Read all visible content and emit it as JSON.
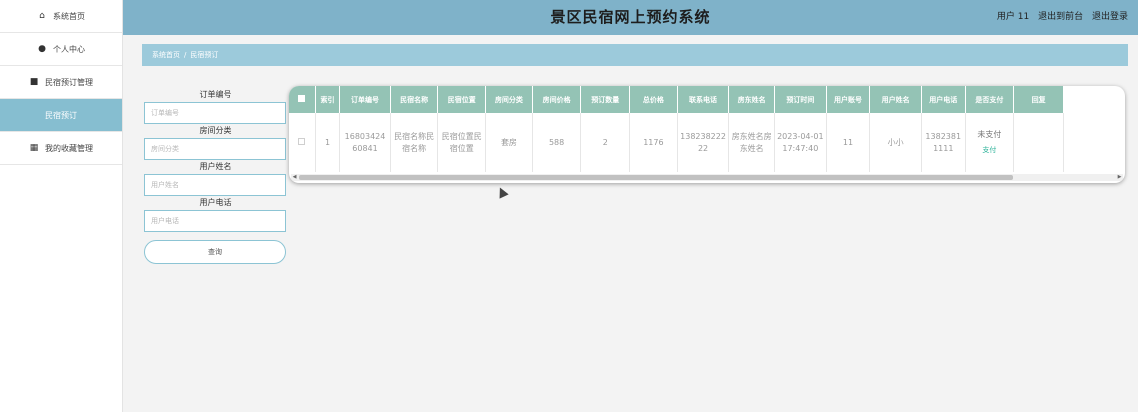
{
  "app": {
    "title": "景区民宿网上预约系统",
    "user_text": "用户 11",
    "back_link": "退出到前台",
    "logout_link": "退出登录"
  },
  "sidebar": {
    "items": [
      {
        "label": "系统首页",
        "icon": "home-icon",
        "glyph": "⌂"
      },
      {
        "label": "个人中心",
        "icon": "user-icon",
        "glyph": "●"
      },
      {
        "label": "民宿预订管理",
        "icon": "briefcase-icon",
        "glyph": "■"
      },
      {
        "label": "民宿预订",
        "icon": "",
        "glyph": ""
      },
      {
        "label": "我的收藏管理",
        "icon": "grid-icon",
        "glyph": "▦"
      }
    ]
  },
  "breadcrumb": {
    "home": "系统首页",
    "separator": "/",
    "current": "民宿预订"
  },
  "search": {
    "fields": [
      {
        "label": "订单编号",
        "placeholder": "订单编号"
      },
      {
        "label": "房间分类",
        "placeholder": "房间分类"
      },
      {
        "label": "用户姓名",
        "placeholder": "用户姓名"
      },
      {
        "label": "用户电话",
        "placeholder": "用户电话"
      }
    ],
    "button": "查询"
  },
  "table": {
    "headers": [
      "索引",
      "订单编号",
      "民宿名称",
      "民宿位置",
      "房间分类",
      "房间价格",
      "预订数量",
      "总价格",
      "联系电话",
      "房东姓名",
      "预订时间",
      "用户账号",
      "用户姓名",
      "用户电话",
      "是否支付",
      "回复"
    ],
    "rows": [
      {
        "index": "1",
        "order_no": "1680342460841",
        "homestay_name": "民宿名称民宿名称",
        "homestay_location": "民宿位置民宿位置",
        "room_type": "套房",
        "room_price": "588",
        "quantity": "2",
        "total_price": "1176",
        "contact_phone": "13823822222",
        "landlord_name": "房东姓名房东姓名",
        "booking_time": "2023-04-01 17:47:40",
        "user_account": "11",
        "user_name": "小小",
        "user_phone": "13823811111",
        "payment_status": "未支付",
        "pay_action": "支付",
        "reply": ""
      }
    ]
  },
  "colors": {
    "topbar": "#7fb2c9",
    "breadcrumb": "#9ccadb",
    "table_header": "#94c3b5",
    "sidebar_active": "#86bed0",
    "pay_link": "#2db39a"
  }
}
